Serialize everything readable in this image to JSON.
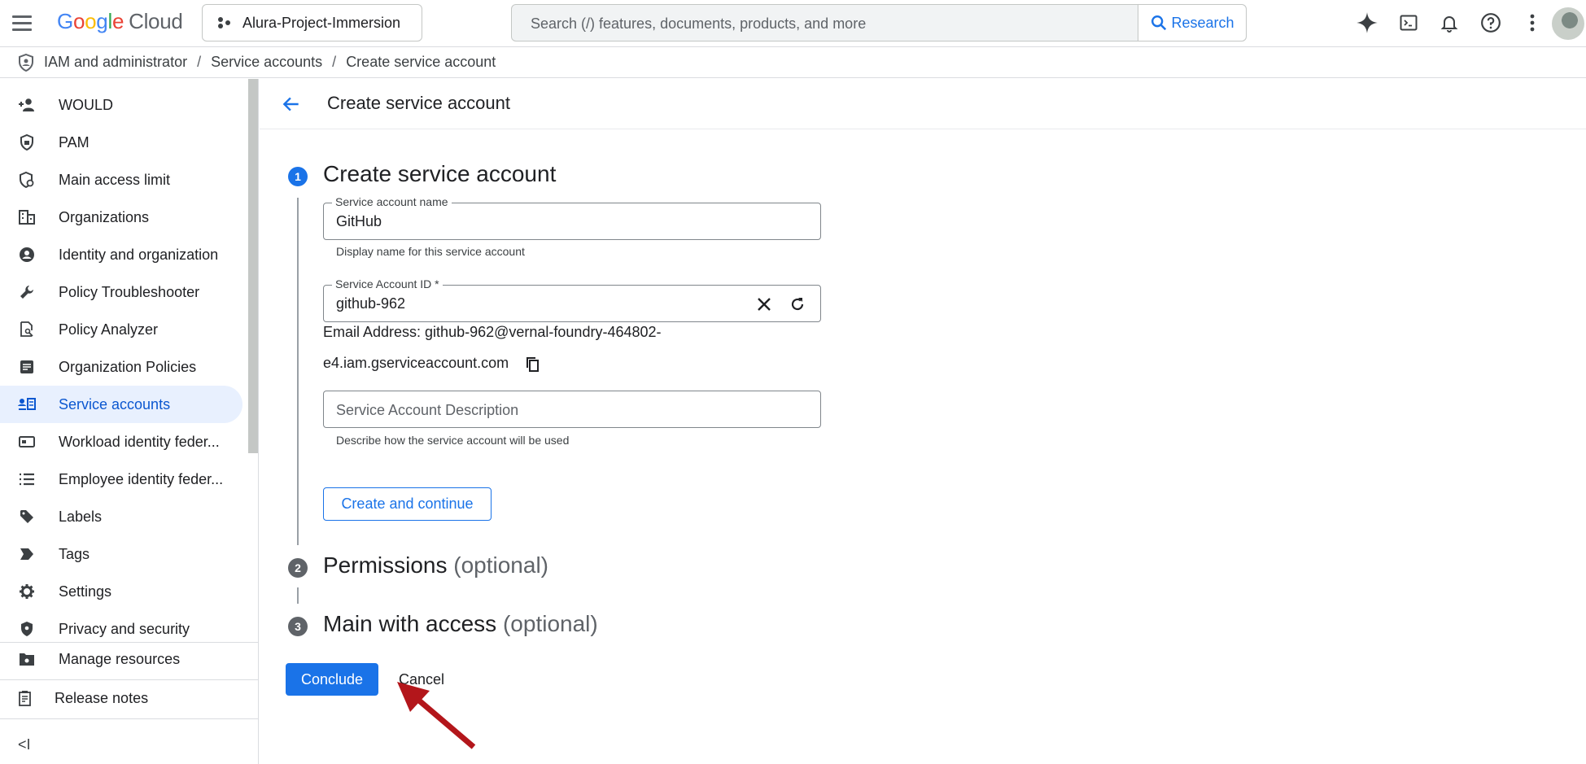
{
  "header": {
    "logo_google": "Google",
    "logo_cloud": "Cloud",
    "project_name": "Alura-Project-Immersion",
    "search_placeholder": "Search (/) features, documents, products, and more",
    "search_button": "Research"
  },
  "breadcrumb": [
    "IAM and administrator",
    "Service accounts",
    "Create service account"
  ],
  "breadcrumb_sep": "/",
  "sidebar": {
    "items": [
      {
        "label": "WOULD",
        "icon": "person-add-icon"
      },
      {
        "label": "PAM",
        "icon": "shield-lock-icon"
      },
      {
        "label": "Main access limit",
        "icon": "shield-person-icon"
      },
      {
        "label": "Organizations",
        "icon": "building-icon"
      },
      {
        "label": "Identity and organization",
        "icon": "account-circle-icon"
      },
      {
        "label": "Policy Troubleshooter",
        "icon": "wrench-icon"
      },
      {
        "label": "Policy Analyzer",
        "icon": "doc-search-icon"
      },
      {
        "label": "Organization Policies",
        "icon": "article-icon"
      },
      {
        "label": "Service accounts",
        "icon": "service-account-icon",
        "active": true
      },
      {
        "label": "Workload identity feder...",
        "icon": "id-card-icon"
      },
      {
        "label": "Employee identity feder...",
        "icon": "list-icon"
      },
      {
        "label": "Labels",
        "icon": "label-icon"
      },
      {
        "label": "Tags",
        "icon": "tag-icon"
      },
      {
        "label": "Settings",
        "icon": "gear-icon"
      },
      {
        "label": "Privacy and security",
        "icon": "privacy-shield-icon"
      }
    ],
    "manage_resources": "Manage resources",
    "release_notes": "Release notes",
    "collapse": "<I"
  },
  "page": {
    "title": "Create service account",
    "steps": [
      {
        "number": "1",
        "title": "Create service account",
        "optional": ""
      },
      {
        "number": "2",
        "title": "Permissions",
        "optional": "(optional)"
      },
      {
        "number": "3",
        "title": "Main with access",
        "optional": "(optional)"
      }
    ],
    "form": {
      "name_label": "Service account name",
      "name_value": "GitHub",
      "name_hint": "Display name for this service account",
      "id_label": "Service Account ID *",
      "id_value": "github-962",
      "email_line1": "Email Address: github-962@vernal-foundry-464802-",
      "email_line2": "e4.iam.gserviceaccount.com",
      "desc_placeholder": "Service Account Description",
      "desc_hint": "Describe how the service account will be used",
      "create_button": "Create and continue"
    },
    "conclude_button": "Conclude",
    "cancel_button": "Cancel"
  },
  "colors": {
    "accent": "#1a73e8",
    "active_bg": "#e8f0fe",
    "annotation_arrow": "#b3161b"
  }
}
